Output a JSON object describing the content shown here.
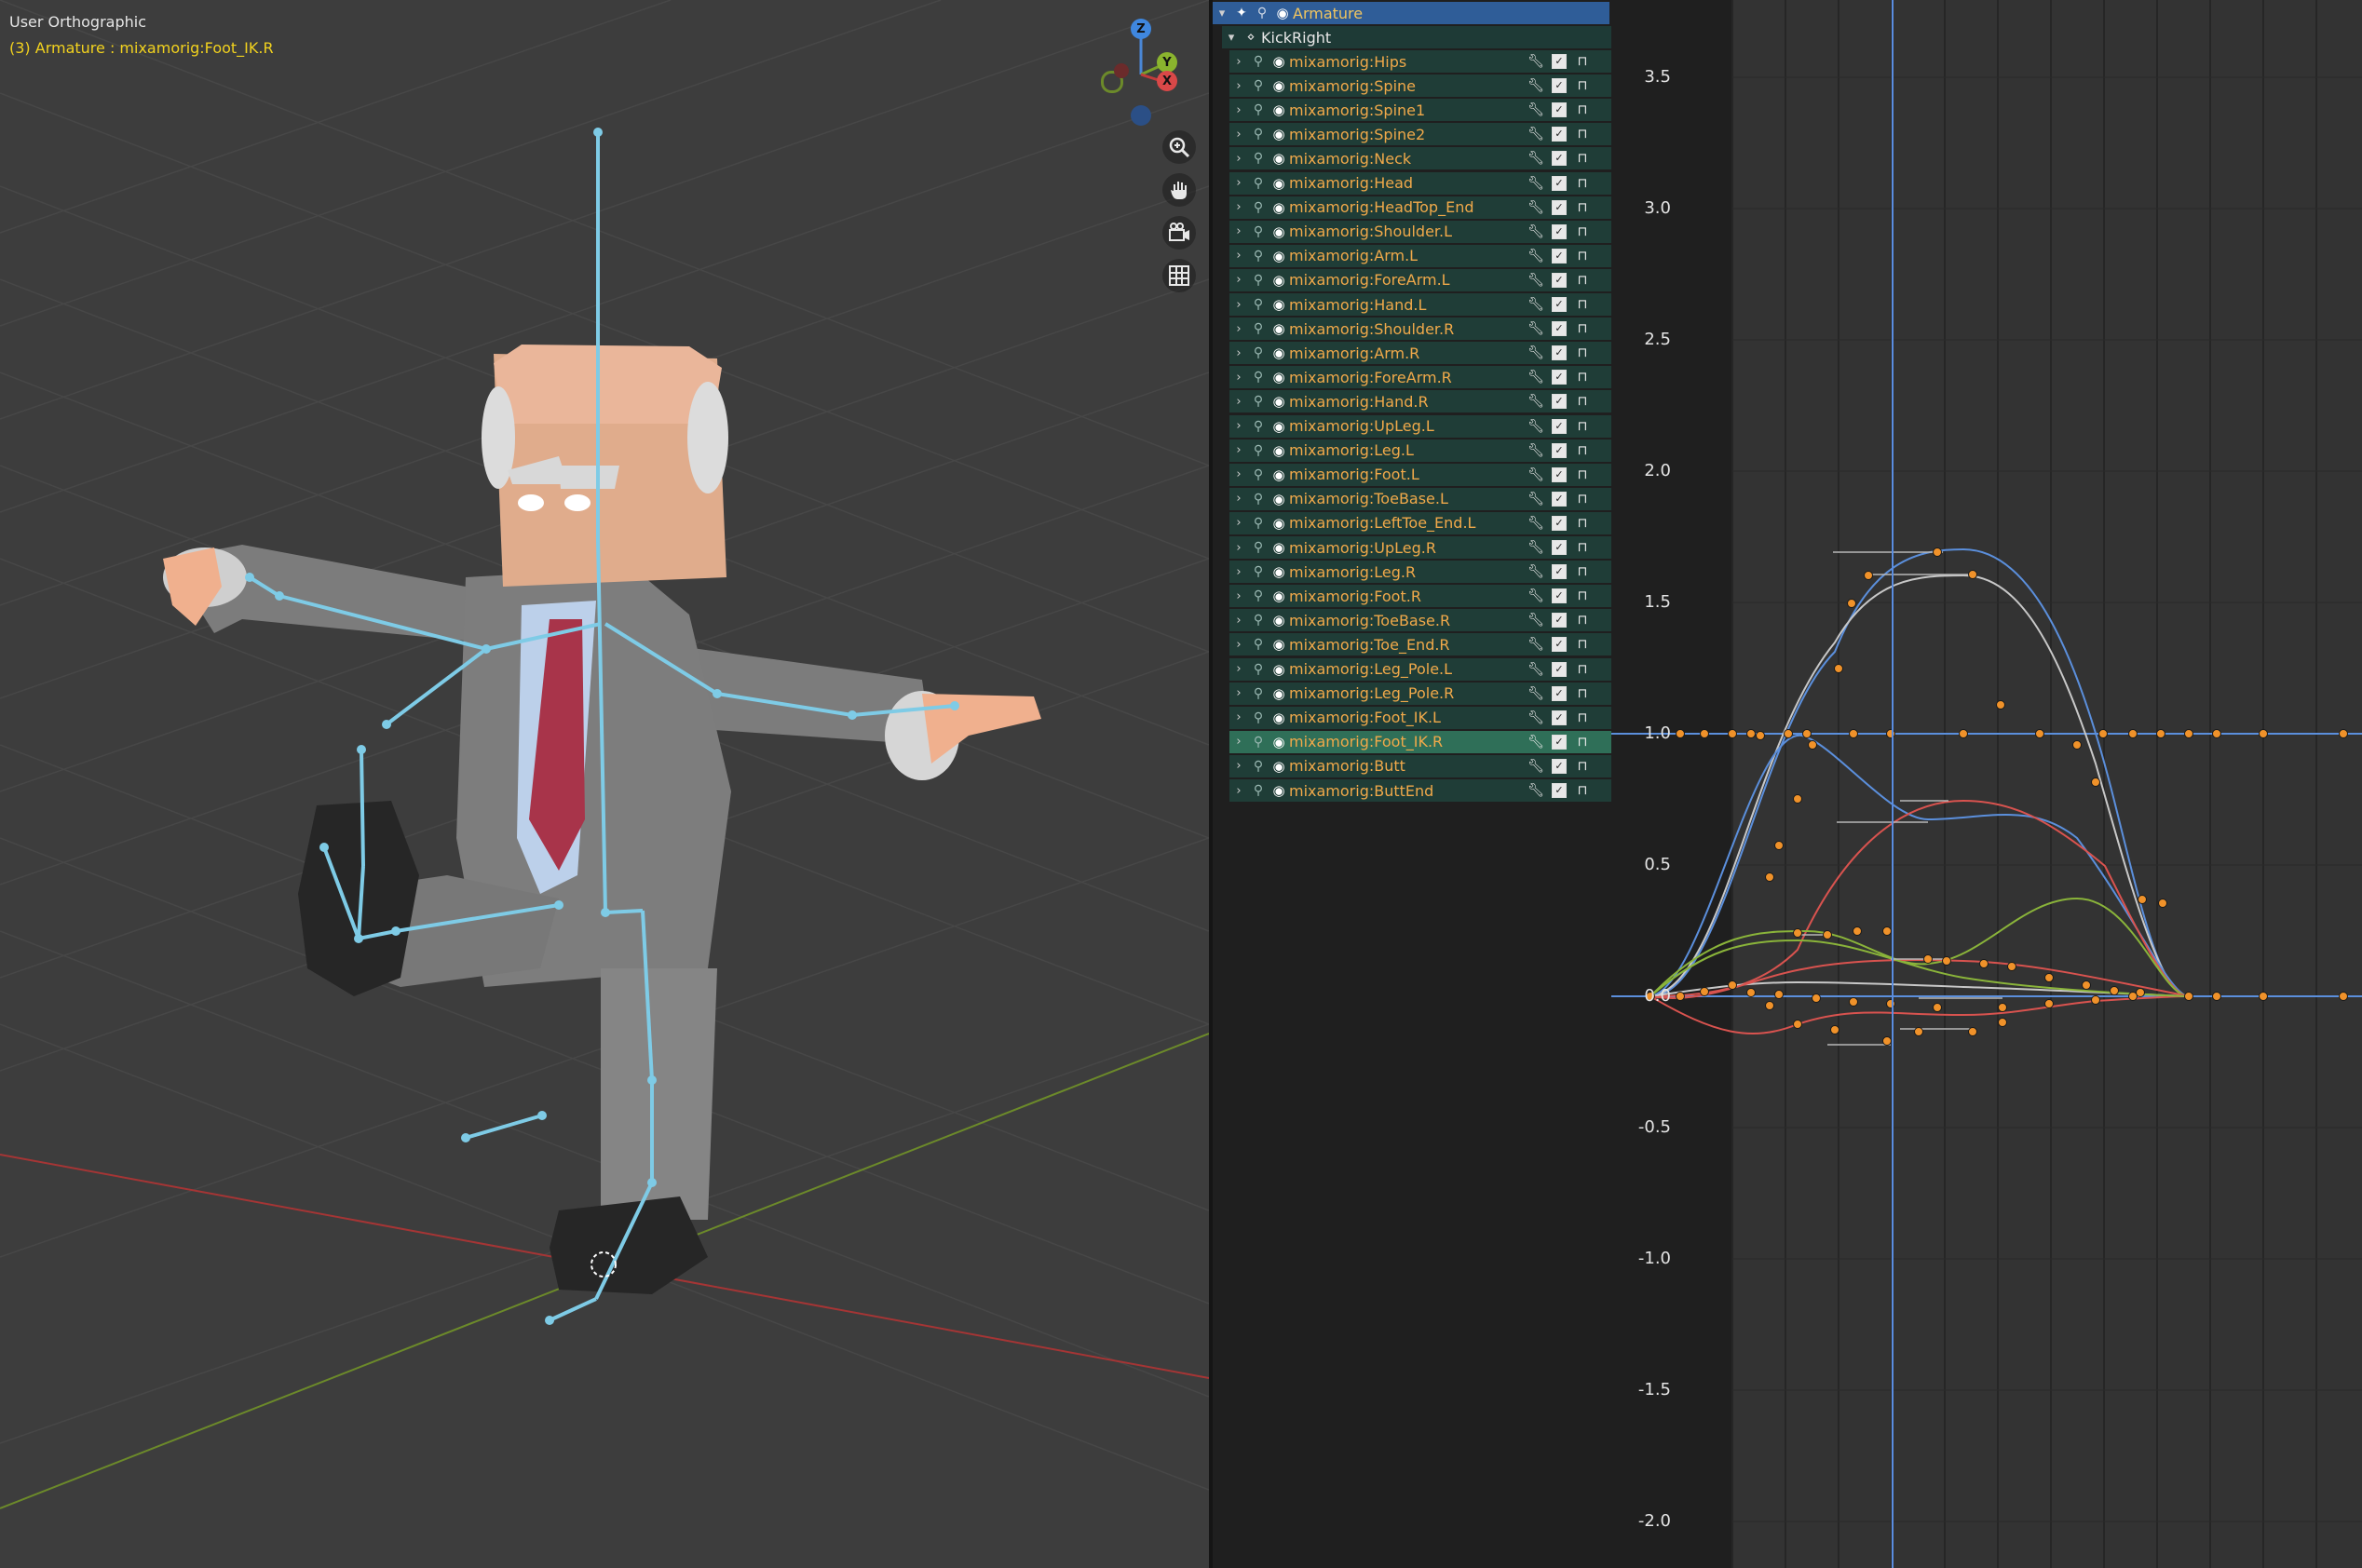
{
  "viewport": {
    "title": "User Orthographic",
    "subtitle": "(3) Armature : mixamorig:Foot_IK.R",
    "gizmo": {
      "z_label": "Z",
      "y_label": "Y",
      "x_label": "X"
    },
    "nav_icons": [
      "zoom-icon",
      "pan-hand-icon",
      "camera-icon",
      "grid-icon"
    ],
    "colors": {
      "bone": "#7ecbe6",
      "x_axis": "#b03a3a",
      "y_axis": "#6a8a2a"
    }
  },
  "outliner": {
    "armature_label": "Armature",
    "action_label": "KickRight",
    "bones": [
      "mixamorig:Hips",
      "mixamorig:Spine",
      "mixamorig:Spine1",
      "mixamorig:Spine2",
      "mixamorig:Neck",
      "mixamorig:Head",
      "mixamorig:HeadTop_End",
      "mixamorig:Shoulder.L",
      "mixamorig:Arm.L",
      "mixamorig:ForeArm.L",
      "mixamorig:Hand.L",
      "mixamorig:Shoulder.R",
      "mixamorig:Arm.R",
      "mixamorig:ForeArm.R",
      "mixamorig:Hand.R",
      "mixamorig:UpLeg.L",
      "mixamorig:Leg.L",
      "mixamorig:Foot.L",
      "mixamorig:ToeBase.L",
      "mixamorig:LeftToe_End.L",
      "mixamorig:UpLeg.R",
      "mixamorig:Leg.R",
      "mixamorig:Foot.R",
      "mixamorig:ToeBase.R",
      "mixamorig:Toe_End.R",
      "mixamorig:Leg_Pole.L",
      "mixamorig:Leg_Pole.R",
      "mixamorig:Foot_IK.L",
      "mixamorig:Foot_IK.R",
      "mixamorig:Butt",
      "mixamorig:ButtEnd"
    ],
    "selected_bone": "mixamorig:Foot_IK.R"
  },
  "graph": {
    "y_ticks": [
      "3.5",
      "3.0",
      "2.5",
      "2.0",
      "1.5",
      "1.0",
      "0.5",
      "0.0",
      "-0.5",
      "-1.0",
      "-1.5",
      "-2.0"
    ],
    "colors": {
      "keyframe": "#f0922a",
      "playhead": "#5a8de0",
      "curve_blue": "#5b8fdc",
      "curve_red": "#d9534f",
      "curve_green": "#8ab43a",
      "curve_white": "#c8c8c8"
    }
  }
}
